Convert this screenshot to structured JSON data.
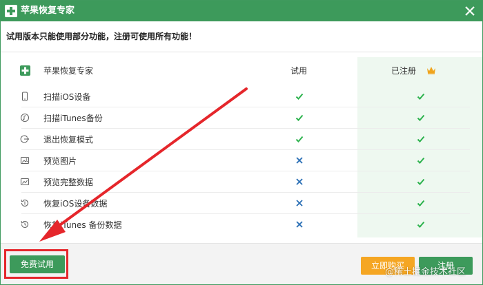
{
  "window": {
    "title": "苹果恢复专家",
    "close_icon": "close-icon"
  },
  "notice": "试用版本只能使用部分功能，注册可使用所有功能！",
  "table": {
    "header": {
      "name": "苹果恢复专家",
      "trial": "试用",
      "registered": "已注册"
    },
    "rows": [
      {
        "label": "扫描iOS设备",
        "icon": "phone-icon",
        "trial": "check",
        "registered": "check"
      },
      {
        "label": "扫描iTunes备份",
        "icon": "music-icon",
        "trial": "check",
        "registered": "check"
      },
      {
        "label": "退出恢复模式",
        "icon": "exit-icon",
        "trial": "check",
        "registered": "check"
      },
      {
        "label": "预览图片",
        "icon": "image-icon",
        "trial": "cross",
        "registered": "check"
      },
      {
        "label": "预览完整数据",
        "icon": "data-icon",
        "trial": "cross",
        "registered": "check"
      },
      {
        "label": "恢复iOS设备数据",
        "icon": "restore-icon",
        "trial": "cross",
        "registered": "check"
      },
      {
        "label": "恢复iTunes 备份数据",
        "icon": "restore-icon",
        "trial": "cross",
        "registered": "check"
      }
    ]
  },
  "footer": {
    "free_trial": "免费试用",
    "buy_now": "立即购买",
    "register": "注册"
  },
  "watermark": "@稀土掘金技术社区",
  "colors": {
    "brand_green": "#3d9a5b",
    "check_green": "#2bb24c",
    "cross_blue": "#2a6fb5",
    "buy_orange": "#f5a623",
    "annotation_red": "#e5262b"
  }
}
